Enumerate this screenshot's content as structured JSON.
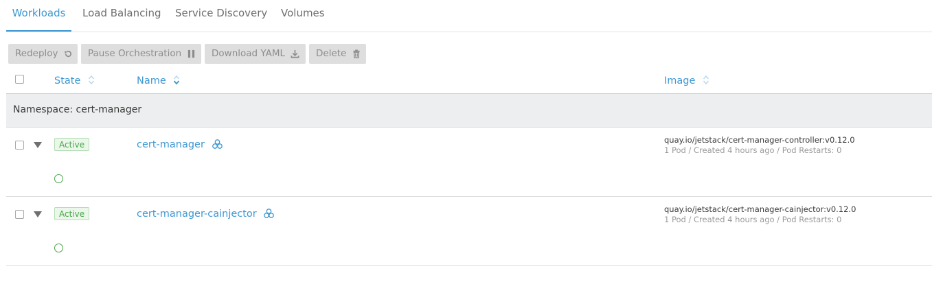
{
  "tabs": [
    {
      "label": "Workloads",
      "active": true
    },
    {
      "label": "Load Balancing",
      "active": false
    },
    {
      "label": "Service Discovery",
      "active": false
    },
    {
      "label": "Volumes",
      "active": false
    }
  ],
  "toolbar": {
    "redeploy": {
      "label": "Redeploy",
      "icon": "redeploy-icon"
    },
    "pause": {
      "label": "Pause Orchestration",
      "icon": "pause-icon"
    },
    "download": {
      "label": "Download YAML",
      "icon": "download-icon"
    },
    "delete": {
      "label": "Delete",
      "icon": "trash-icon"
    }
  },
  "table": {
    "headers": {
      "state": "State",
      "name": "Name",
      "image": "Image"
    },
    "namespace_label": "Namespace: cert-manager",
    "rows": [
      {
        "state": "Active",
        "name": "cert-manager",
        "image": "quay.io/jetstack/cert-manager-controller:v0.12.0",
        "detail": "1 Pod / Created 4 hours ago / Pod Restarts: 0"
      },
      {
        "state": "Active",
        "name": "cert-manager-cainjector",
        "image": "quay.io/jetstack/cert-manager-cainjector:v0.12.0",
        "detail": "1 Pod / Created 4 hours ago / Pod Restarts: 0"
      }
    ]
  },
  "colors": {
    "accent": "#3d98d3",
    "active_green": "#4aa64a",
    "button_bg": "#dedede"
  }
}
